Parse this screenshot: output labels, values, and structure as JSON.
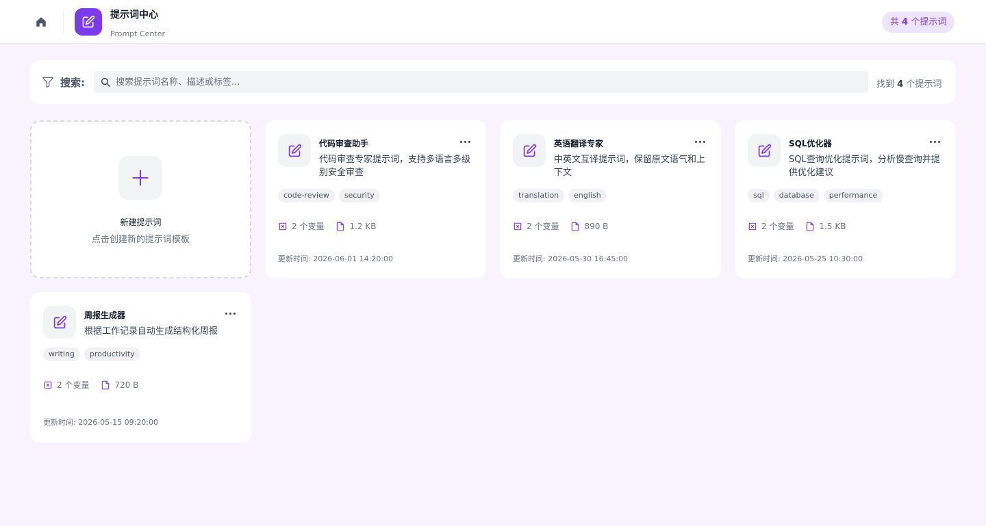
{
  "header": {
    "title": "提示词中心",
    "subtitle": "Prompt Center",
    "count_badge": {
      "prefix": "共 ",
      "count": "4",
      "suffix": " 个提示词"
    }
  },
  "search": {
    "label": "搜索:",
    "placeholder": "搜索提示词名称、描述或标签...",
    "value": "",
    "result_prefix": "找到 ",
    "result_count": "4",
    "result_suffix": " 个提示词"
  },
  "new_card": {
    "title": "新建提示词",
    "description": "点击创建新的提示词模板"
  },
  "prompts": [
    {
      "name": "代码审查助手",
      "description": "代码审查专家提示词，支持多语言多级别安全审查",
      "tags": [
        "code-review",
        "security"
      ],
      "variables": "2 个变量",
      "size": "1.2 KB",
      "updated": "更新时间: 2026-06-01 14:20:00"
    },
    {
      "name": "英语翻译专家",
      "description": "中英文互译提示词，保留原文语气和上下文",
      "tags": [
        "translation",
        "english"
      ],
      "variables": "2 个变量",
      "size": "890 B",
      "updated": "更新时间: 2026-05-30 16:45:00"
    },
    {
      "name": "SQL优化器",
      "description": "SQL查询优化提示词，分析慢查询并提供优化建议",
      "tags": [
        "sql",
        "database",
        "performance"
      ],
      "variables": "2 个变量",
      "size": "1.5 KB",
      "updated": "更新时间: 2026-05-25 10:30:00"
    },
    {
      "name": "周报生成器",
      "description": "根据工作记录自动生成结构化周报",
      "tags": [
        "writing",
        "productivity"
      ],
      "variables": "2 个变量",
      "size": "720 B",
      "updated": "更新时间: 2026-05-15 09:20:00"
    }
  ],
  "icons": {
    "home": "home-icon",
    "logo": "edit-icon",
    "filter": "filter-icon",
    "search": "search-icon",
    "plus": "plus-icon",
    "card": "edit-icon",
    "more": "more-horizontal-icon",
    "variables": "variable-icon",
    "file": "file-icon"
  },
  "colors": {
    "accent": "#7c3aed",
    "page_background": "#f8f3fe",
    "badge_background": "#ede4fd"
  }
}
